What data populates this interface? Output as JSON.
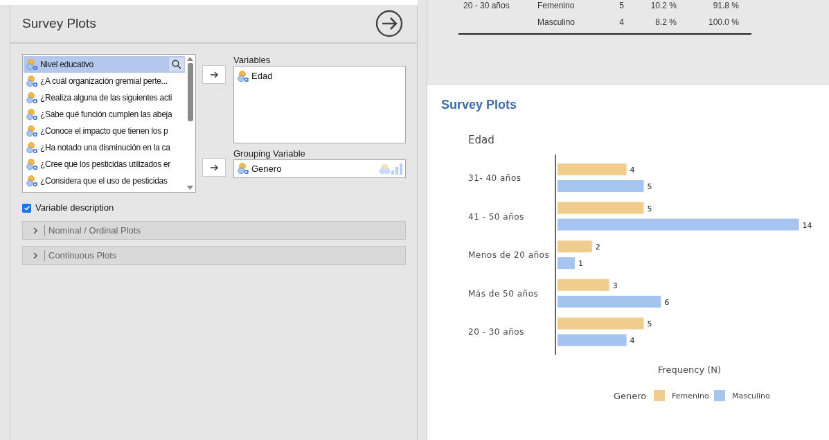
{
  "analysis_panel": {
    "title": "Survey Plots",
    "source_list": [
      {
        "label": "Nivel educativo",
        "selected": true
      },
      {
        "label": "¿A cuál organización gremial perte...",
        "selected": false
      },
      {
        "label": "¿Realiza alguna de las siguientes acti",
        "selected": false
      },
      {
        "label": "¿Sabe qué función cumplen las abeja",
        "selected": false
      },
      {
        "label": "¿Conoce el impacto que tienen los p",
        "selected": false
      },
      {
        "label": "¿Ha notado una disminución en la ca",
        "selected": false
      },
      {
        "label": "¿Cree que los pesticidas utilizados er",
        "selected": false
      },
      {
        "label": "¿Considera que el uso de pesticidas",
        "selected": false
      }
    ],
    "variables": {
      "label": "Variables",
      "items": [
        "Edad"
      ]
    },
    "grouping_variable": {
      "label": "Grouping Variable",
      "value": "Genero"
    },
    "variable_description": {
      "label": "Variable description",
      "checked": true
    },
    "sections": [
      {
        "label": "Nominal / Ordinal Plots",
        "expanded": false
      },
      {
        "label": "Continuous Plots",
        "expanded": false
      }
    ]
  },
  "results": {
    "table_rows": [
      [
        "20 - 30 años",
        "Femenino",
        "5",
        "10.2 %",
        "91.8 %"
      ],
      [
        "",
        "Masculino",
        "4",
        "8.2 %",
        "100.0 %"
      ]
    ],
    "heading": "Survey Plots",
    "chart_data": {
      "type": "bar",
      "orientation": "horizontal",
      "title": "Edad",
      "xlabel": "Frequency (N)",
      "categories": [
        "31- 40 años",
        "41 - 50 años",
        "Menos de 20 años",
        "Más de 50 años",
        "20 - 30 años"
      ],
      "series": [
        {
          "name": "Femenino",
          "color": "#f0cd8d",
          "values": [
            4,
            5,
            2,
            3,
            5
          ]
        },
        {
          "name": "Masculino",
          "color": "#a6c4f0",
          "values": [
            5,
            14,
            1,
            6,
            4
          ]
        }
      ],
      "data_labels": true,
      "legend": {
        "title": "Genero"
      }
    }
  }
}
